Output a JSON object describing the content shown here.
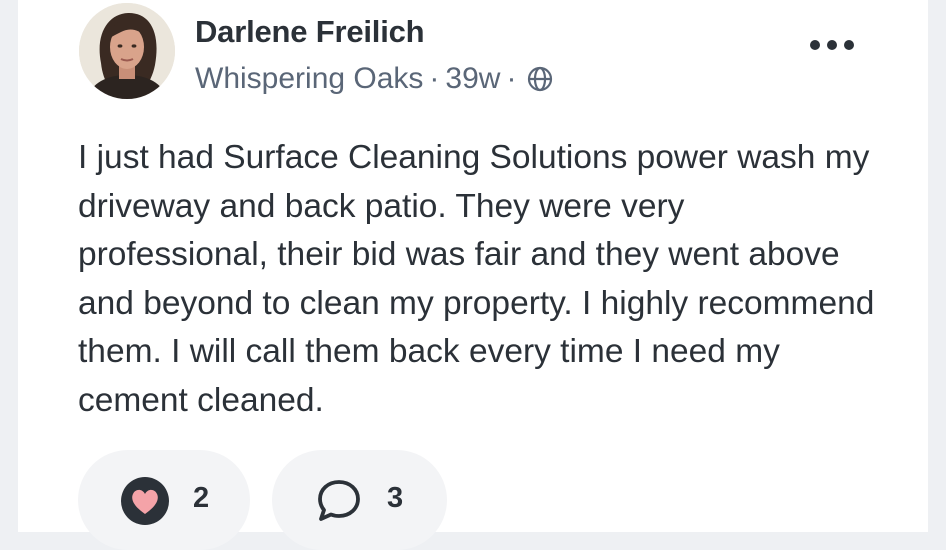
{
  "post": {
    "author_name": "Darlene Freilich",
    "neighborhood": "Whispering Oaks",
    "separator": "·",
    "time_ago": "39w",
    "visibility_icon": "globe-icon",
    "more_icon": "more-horizontal-icon",
    "body": "I just had Surface Cleaning Solutions power wash my driveway and back patio. They were very professional, their bid was fair and they went above and beyond to clean my property. I highly recommend them. I will call them back every time I need my cement cleaned."
  },
  "actions": {
    "like_icon": "heart-icon",
    "like_count": "2",
    "comment_icon": "speech-bubble-icon",
    "comment_count": "3"
  },
  "colors": {
    "text": "#2b3138",
    "meta_text": "#5a6677",
    "heart_fill": "#f4a3a8",
    "heart_ring": "#2b3138",
    "pill_bg": "#f3f4f6",
    "page_bg": "#eef0f3"
  }
}
